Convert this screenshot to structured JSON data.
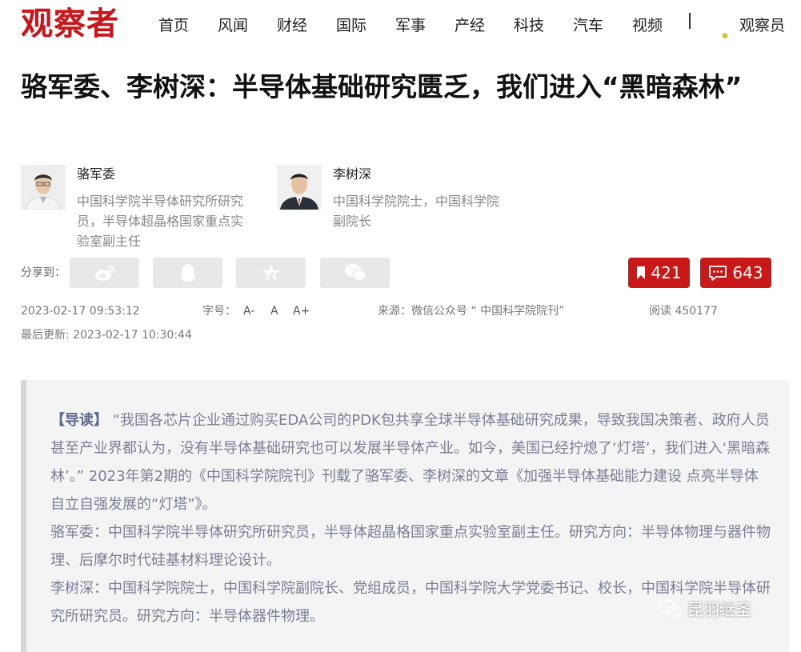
{
  "site": {
    "logo": "观察者"
  },
  "nav": {
    "items": [
      "首页",
      "风闻",
      "财经",
      "国际",
      "军事",
      "产经",
      "科技",
      "汽车",
      "视频"
    ],
    "member": "观察员"
  },
  "article": {
    "title": "骆军委、李树深：半导体基础研究匮乏，我们进入“黑暗森林”",
    "authors": [
      {
        "name": "骆军委",
        "desc": "中国科学院半导体研究所研究员，半导体超晶格国家重点实验室副主任"
      },
      {
        "name": "李树深",
        "desc": "中国科学院院士，中国科学院副院长"
      }
    ],
    "share_label": "分享到：",
    "share_icons": [
      "weibo-icon",
      "qq-icon",
      "qzone-star-icon",
      "wechat-icon"
    ],
    "favorites": "421",
    "comments": "643",
    "published": "2023-02-17 09:53:12",
    "font_label": "字号：",
    "font_sizes": [
      "A-",
      "A",
      "A+"
    ],
    "source": "来源：微信公众号 “ 中国科学院院刊”",
    "reads": "阅读 450177",
    "updated": "最后更新: 2023-02-17 10:30:44"
  },
  "summary": {
    "tag": "【导读】",
    "lead": " “我国各芯片企业通过购买EDA公司的PDK包共享全球半导体基础研究成果，导致我国决策者、政府人员甚至产业界都认为，没有半导体基础研究也可以发展半导体产业。如今，美国已经拧熄了‘灯塔’，我们进入‘黑暗森林’。” 2023年第2期的《中国科学院院刊》刊载了骆军委、李树深的文章《加强半导体基础能力建设 点亮半导体自立自强发展的“灯塔”》。",
    "author1": "骆军委：中国科学院半导体研究所研究员，半导体超晶格国家重点实验室副主任。研究方向：半导体物理与器件物理、后摩尔时代硅基材料理论设计。",
    "author2": "李树深：中国科学院院士，中国科学院副院长、党组成员，中国科学院大学党委书记、校长，中国科学院半导体研究所研究员。研究方向：半导体器件物理。"
  },
  "watermark": "昆羽继圣",
  "colors": {
    "brand": "#c8161d",
    "stat_button": "#c81818",
    "summary_text": "#7a7f95"
  }
}
